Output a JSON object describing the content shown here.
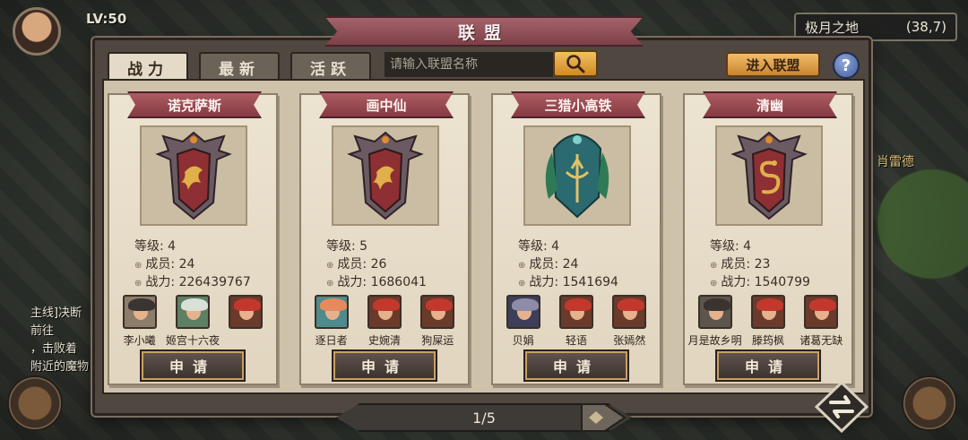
{
  "player": {
    "level": "LV:50"
  },
  "location": {
    "name": "极月之地",
    "coords": "(38,7)"
  },
  "side": {
    "npc_label": "肖雷德"
  },
  "quest": {
    "lines": [
      "主线]决断",
      "前往",
      "，击败着",
      "附近的魔物"
    ]
  },
  "panel": {
    "title": "联盟"
  },
  "tabs": [
    {
      "label": "战力",
      "active": true
    },
    {
      "label": "最新",
      "active": false
    },
    {
      "label": "活跃",
      "active": false
    }
  ],
  "search": {
    "placeholder": "请输入联盟名称",
    "icon": "search-icon"
  },
  "enter_button": "进入联盟",
  "help_button": "?",
  "labels": {
    "level": "等级: ",
    "members": "成员: ",
    "power": "战力: ",
    "apply": "申请"
  },
  "alliances": [
    {
      "name": "诺克萨斯",
      "level": "4",
      "members": "24",
      "power": "226439767",
      "emblem": "dragon-crest-red",
      "member_list": [
        {
          "name": "李小曦",
          "hair": "#3a3432"
        },
        {
          "name": "姬宫十六夜",
          "hair": "#d8e0d8"
        },
        {
          "name": "",
          "hair": "#c2382c"
        }
      ]
    },
    {
      "name": "画中仙",
      "level": "5",
      "members": "26",
      "power": "1686041",
      "emblem": "dragon-crest-red",
      "member_list": [
        {
          "name": "逐日者",
          "hair": "#e58a5c"
        },
        {
          "name": "史婉清",
          "hair": "#c2382c"
        },
        {
          "name": "狗屎运",
          "hair": "#c2382c"
        }
      ]
    },
    {
      "name": "三猎小高铁",
      "level": "4",
      "members": "24",
      "power": "1541694",
      "emblem": "trident-crest-teal",
      "member_list": [
        {
          "name": "贝娟",
          "hair": "#8f8ca8"
        },
        {
          "name": "轻语",
          "hair": "#c2382c"
        },
        {
          "name": "张嫣然",
          "hair": "#c2382c"
        }
      ]
    },
    {
      "name": "清幽",
      "level": "4",
      "members": "23",
      "power": "1540799",
      "emblem": "serpent-crest-red",
      "member_list": [
        {
          "name": "月是故乡明",
          "hair": "#3b3330"
        },
        {
          "name": "滕筠枫",
          "hair": "#c2382c"
        },
        {
          "name": "诸葛无缺",
          "hair": "#c2382c"
        }
      ]
    }
  ],
  "pagination": {
    "text": "1/5"
  },
  "colors": {
    "accent_gold": "#e3a54a",
    "banner_red": "#8e3f46",
    "card_bg": "#e6dcc8",
    "teal_crest": "#1f5f66"
  }
}
